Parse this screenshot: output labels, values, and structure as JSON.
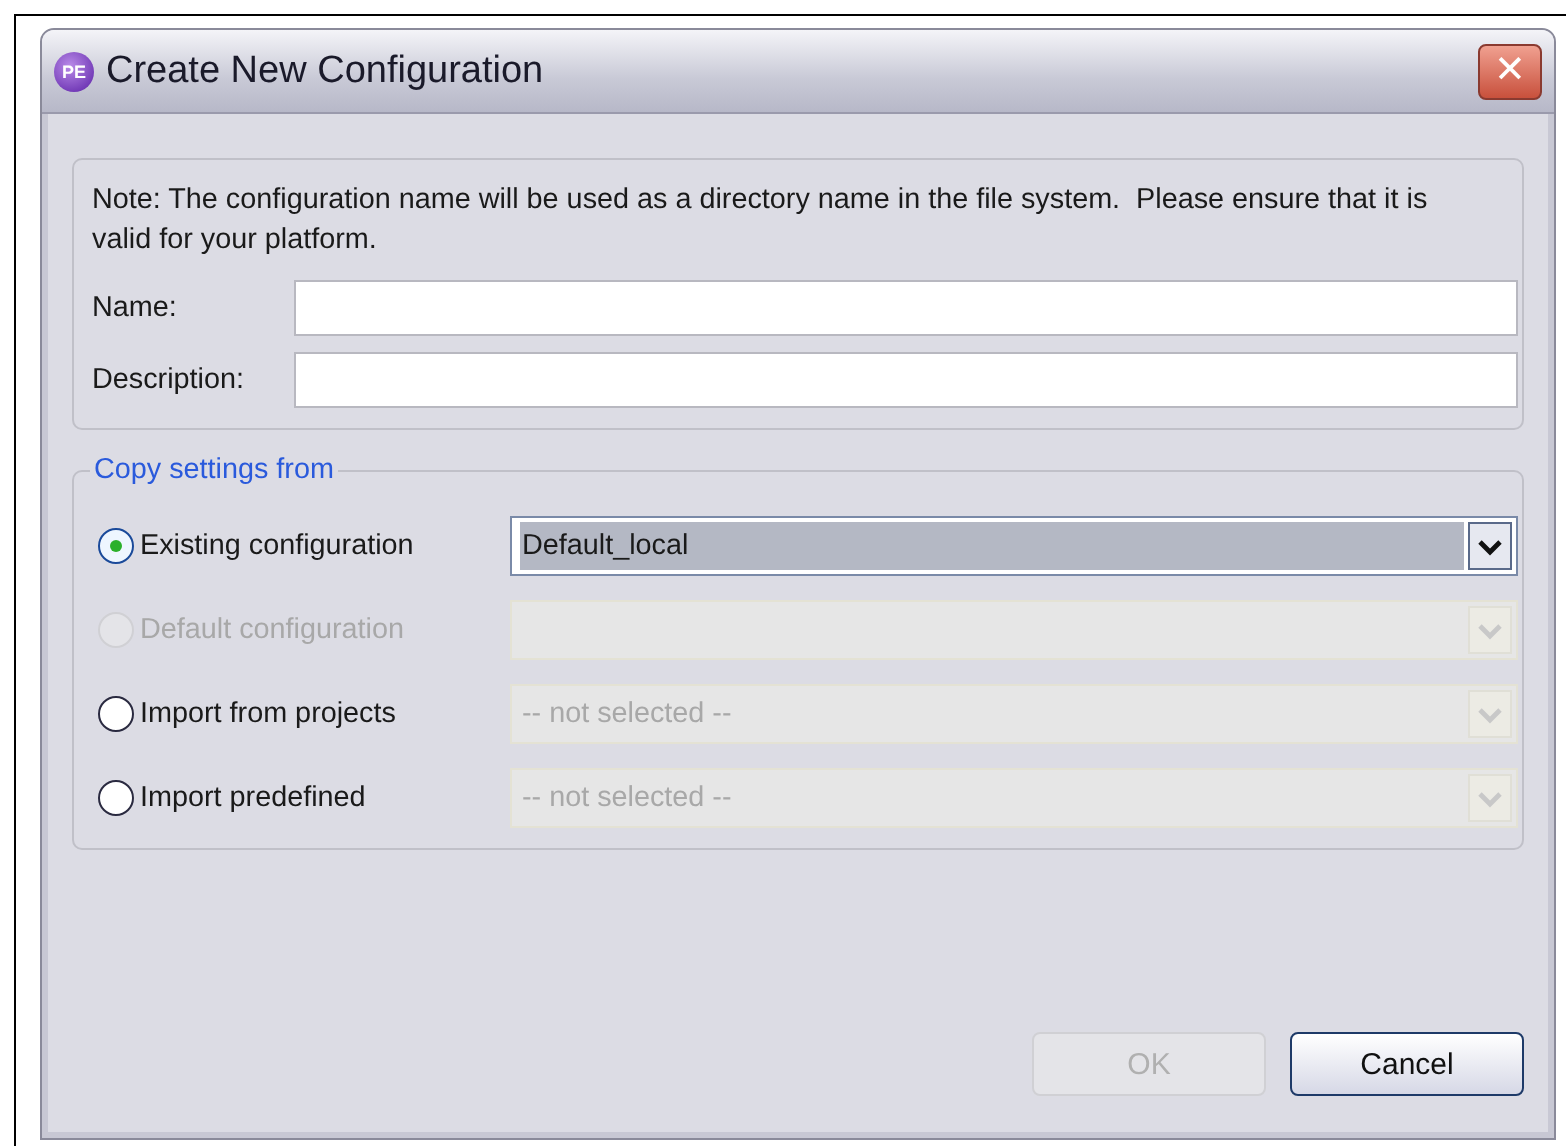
{
  "window": {
    "title": "Create New Configuration",
    "icon_text": "PE",
    "close": "✕"
  },
  "note": "Note: The configuration name will be used as a directory name in the file system.  Please ensure that it is valid for your platform.",
  "fields": [
    {
      "label": "Name:"
    },
    {
      "label": "Description:"
    }
  ],
  "copy_group": {
    "title": "Copy settings from",
    "options": [
      {
        "label": "Existing configuration",
        "selected": true,
        "disabled": false,
        "combo": {
          "value": "Default_local",
          "disabled": false
        }
      },
      {
        "label": "Default configuration",
        "selected": false,
        "disabled": true,
        "combo": {
          "disabled": true
        }
      },
      {
        "label": "Import from projects",
        "selected": false,
        "disabled": false,
        "combo": {
          "value": "-- not selected --",
          "disabled": true
        }
      },
      {
        "label": "Import predefined",
        "selected": false,
        "disabled": false,
        "combo": {
          "value": "-- not selected --",
          "disabled": true
        }
      }
    ]
  },
  "buttons": [
    {
      "label": "OK",
      "disabled": true
    },
    {
      "label": "Cancel",
      "disabled": false
    }
  ]
}
